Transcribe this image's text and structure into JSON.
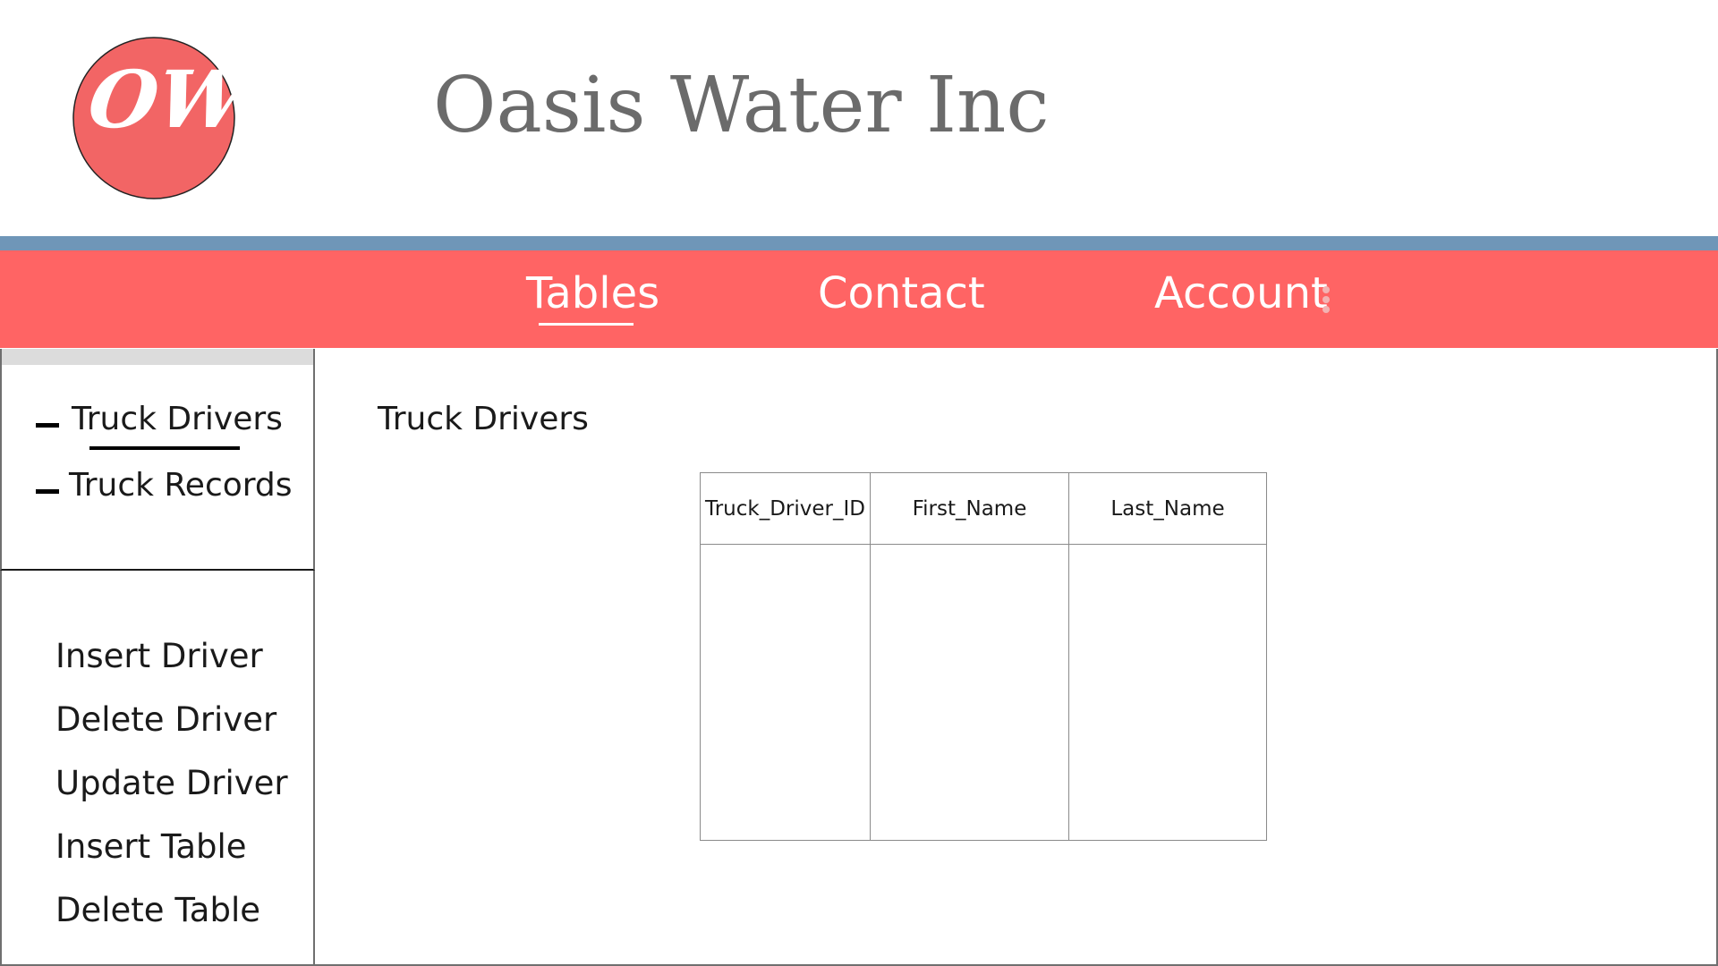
{
  "header": {
    "logo_text": "OW",
    "company_name": "Oasis Water Inc"
  },
  "nav": {
    "items": [
      {
        "label": "Tables",
        "active": true
      },
      {
        "label": "Contact",
        "active": false
      },
      {
        "label": "Account",
        "active": false
      }
    ],
    "menu_icon": "kebab-menu-icon"
  },
  "sidebar": {
    "tables": [
      {
        "label": "Truck Drivers",
        "active": true
      },
      {
        "label": "Truck Records",
        "active": false
      }
    ],
    "actions": [
      {
        "label": "Insert Driver"
      },
      {
        "label": "Delete Driver"
      },
      {
        "label": "Update Driver"
      },
      {
        "label": "Insert Table"
      },
      {
        "label": "Delete Table"
      }
    ]
  },
  "main": {
    "title": "Truck Drivers",
    "table": {
      "columns": [
        "Truck_Driver_ID",
        "First_Name",
        "Last_Name"
      ],
      "rows": []
    }
  },
  "colors": {
    "brand_coral": "#ff6464",
    "stripe_blue": "#6f96b8",
    "logo_circle": "#f26565",
    "title_gray": "#6b6b6b"
  }
}
